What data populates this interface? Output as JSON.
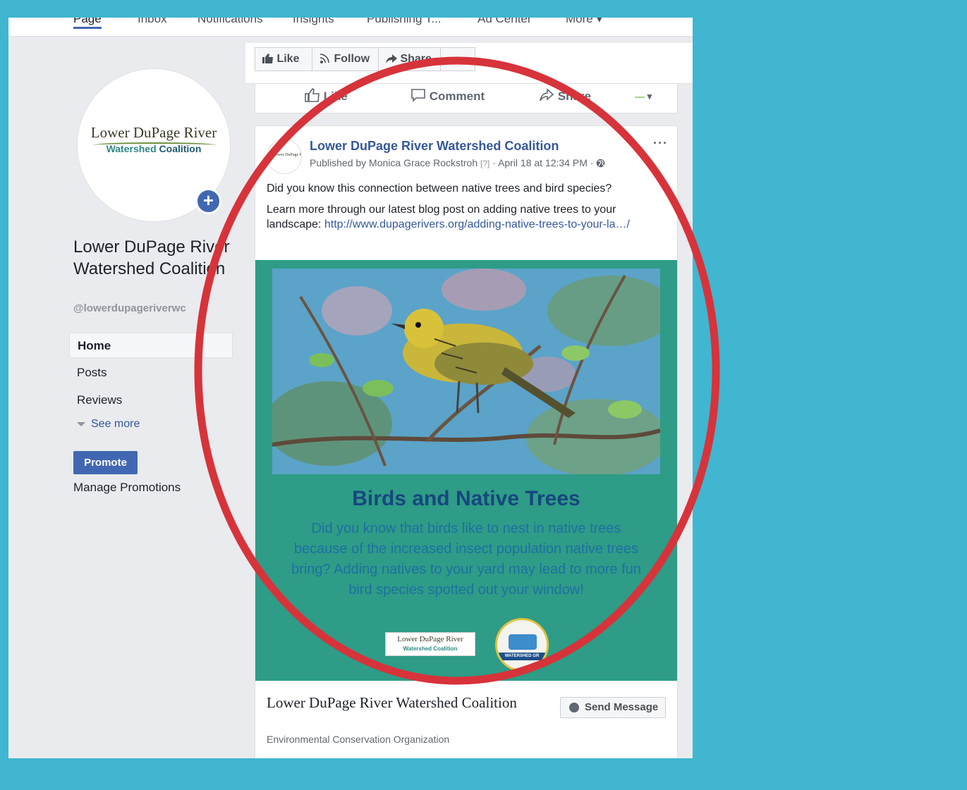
{
  "topnav": {
    "tabs": [
      "Page",
      "Inbox",
      "Notifications",
      "Insights",
      "Publishing T...",
      "Ad Center",
      "More ▾"
    ]
  },
  "page": {
    "logo_line1": "Lower DuPage River",
    "logo_line2a": "Watershed",
    "logo_line2b": "Coalition",
    "name": "Lower DuPage River Watershed Coalition",
    "handle": "@lowerdupageriverwc"
  },
  "sidebar": {
    "items": [
      {
        "label": "Home"
      },
      {
        "label": "Posts"
      },
      {
        "label": "Reviews"
      }
    ],
    "see_more": "See more",
    "promote": "Promote",
    "manage_promotions": "Manage Promotions"
  },
  "floatbar": {
    "like": "Like",
    "follow": "Follow",
    "share": "Share"
  },
  "actions": {
    "like": "Like",
    "comment": "Comment",
    "share": "Share"
  },
  "post": {
    "page_name": "Lower DuPage River Watershed Coalition",
    "published_by": "Published by Monica Grace Rockstroh",
    "q": "[?]",
    "date": "· April 18 at 12:34 PM ·",
    "more": "···",
    "text1": "Did you know this connection between native trees and bird species?",
    "text2": "Learn more through our latest blog post on adding native trees to your landscape:",
    "link": "http://www.dupagerivers.org/adding-native-trees-to-your-la…/"
  },
  "graphic": {
    "title": "Birds and Native Trees",
    "body": "Did you know that birds like to nest in native trees because of the increased insect population native trees bring? Adding natives to your yard may lead to more fun bird species spotted out your window!",
    "logo1_line1": "Lower DuPage River",
    "logo1_line2": "Watershed Coalition",
    "logo2_band": "WATERSHED GR"
  },
  "org_card": {
    "name": "Lower DuPage River Watershed Coalition",
    "category": "Environmental Conservation Organization",
    "send_message": "Send Message"
  },
  "colors": {
    "background": "#40b6d0",
    "fb_blue": "#4267b2",
    "highlight": "#d7333b",
    "graphic_bg": "#2e9c86"
  }
}
